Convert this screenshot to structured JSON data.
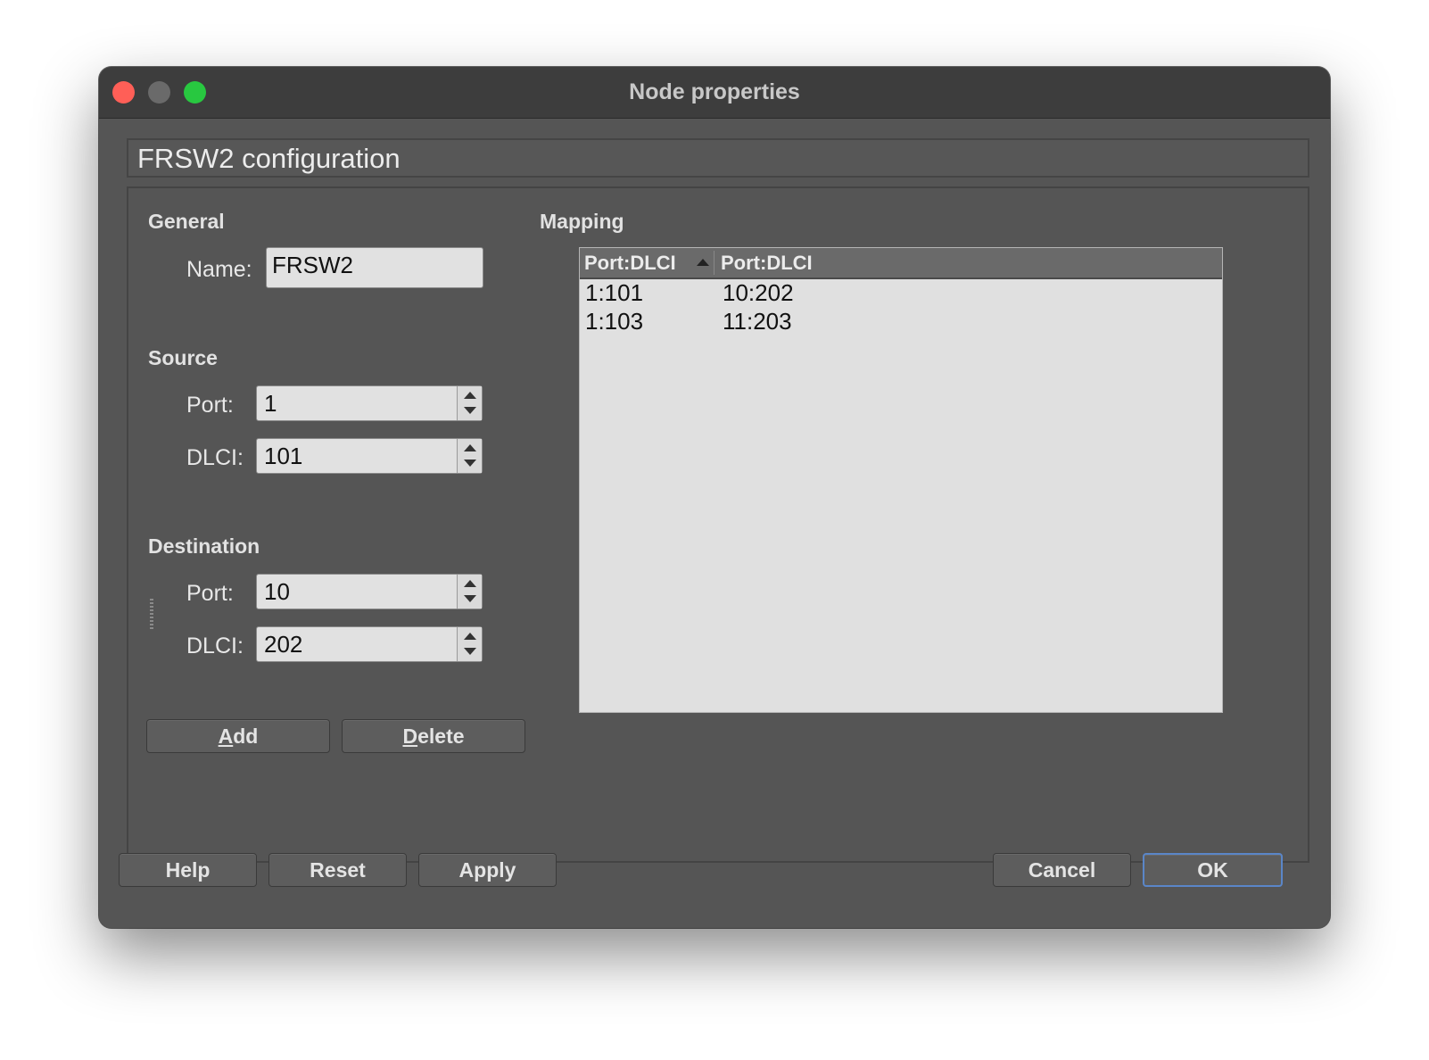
{
  "window": {
    "title": "Node properties"
  },
  "config_header": "FRSW2 configuration",
  "general": {
    "title": "General",
    "name_label": "Name:",
    "name_value": "FRSW2"
  },
  "source": {
    "title": "Source",
    "port_label": "Port:",
    "port_value": "1",
    "dlci_label": "DLCI:",
    "dlci_value": "101"
  },
  "destination": {
    "title": "Destination",
    "port_label": "Port:",
    "port_value": "10",
    "dlci_label": "DLCI:",
    "dlci_value": "202"
  },
  "actions": {
    "add_prefix": "",
    "add_mnemonic": "A",
    "add_rest": "dd",
    "delete_prefix": "",
    "delete_mnemonic": "D",
    "delete_rest": "elete"
  },
  "mapping": {
    "title": "Mapping",
    "columns": [
      "Port:DLCI",
      "Port:DLCI"
    ],
    "sort": "ascending",
    "rows": [
      [
        "1:101",
        "10:202"
      ],
      [
        "1:103",
        "11:203"
      ]
    ]
  },
  "footer": {
    "help": "Help",
    "reset": "Reset",
    "apply": "Apply",
    "cancel": "Cancel",
    "ok": "OK"
  },
  "colors": {
    "close": "#ff5f57",
    "minimize": "#6a6a6a",
    "maximize": "#28c840",
    "default_button_border": "#5a86c8"
  }
}
